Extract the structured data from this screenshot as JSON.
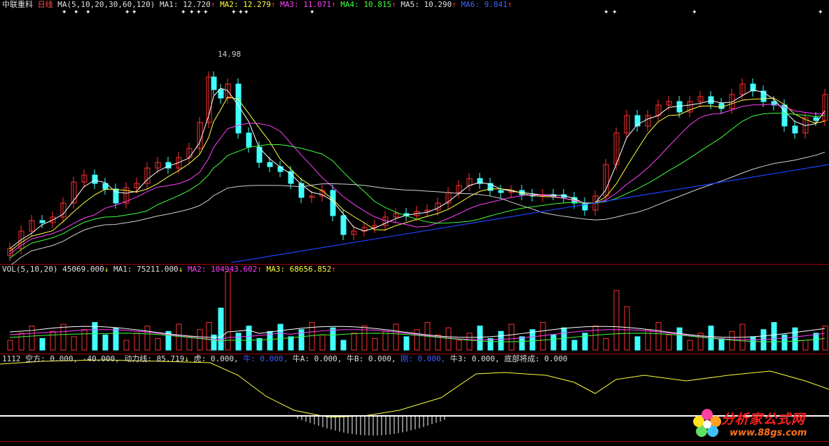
{
  "price_header": {
    "stock_name": "中联重科",
    "period": "日线",
    "ma_label": "MA(5,10,20,30,60,120)",
    "ma1": "MA1: 12.720",
    "ma2": "MA2: 12.279",
    "ma3": "MA3: 11.071",
    "ma4": "MA4: 10.815",
    "ma5": "MA5: 10.290",
    "ma6": "MA6: 9.841",
    "up_arrow": "↑",
    "down_arrow": "↓"
  },
  "high_label": "14.98",
  "vol_header": {
    "label": "VOL(5,10,20)",
    "vol": "45069.000",
    "ma1": "MA1: 75211.000",
    "ma2": "MA2: 104943.602",
    "ma3": "MA3: 68656.852"
  },
  "ind_header": {
    "code": "1112",
    "kong": "空方: 0.000, -40.000,",
    "dongli": "动力线: 85.719",
    "hu": "虎: 0.000,",
    "niu": "牛: 0.000,",
    "niua": "牛A: 0.000,",
    "niub": "牛B: 0.000,",
    "gang": "刚: 0.000,",
    "niu3": "牛3: 0.000,",
    "dibu": "底部将成: 0.000"
  },
  "logo": {
    "text": "分析家公式网",
    "url": "www.88gs.com"
  },
  "colors": {
    "up": "#ff3030",
    "down": "#40ffff",
    "ma1": "#ffffff",
    "ma2": "#ffff40",
    "ma3": "#ff40ff",
    "ma4": "#40ff40",
    "ma5": "#d0d0d0",
    "ma6": "#2040ff"
  }
}
